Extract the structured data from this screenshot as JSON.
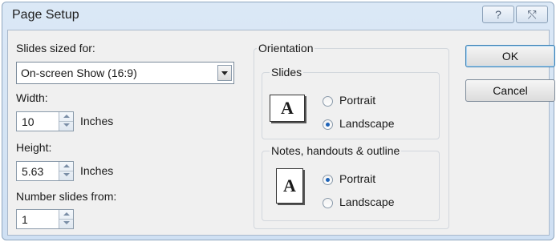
{
  "window": {
    "title": "Page Setup",
    "help_glyph": "?",
    "close_glyph": "⤲"
  },
  "slides_sized_for": {
    "label": "Slides sized for:",
    "selected": "On-screen Show (16:9)"
  },
  "width": {
    "label": "Width:",
    "value": "10",
    "unit": "Inches"
  },
  "height": {
    "label": "Height:",
    "value": "5.63",
    "unit": "Inches"
  },
  "number_slides_from": {
    "label": "Number slides from:",
    "value": "1"
  },
  "orientation": {
    "label": "Orientation",
    "slides": {
      "label": "Slides",
      "icon_glyph": "A",
      "options": [
        {
          "label": "Portrait",
          "selected": false
        },
        {
          "label": "Landscape",
          "selected": true
        }
      ]
    },
    "notes": {
      "label": "Notes, handouts & outline",
      "icon_glyph": "A",
      "options": [
        {
          "label": "Portrait",
          "selected": true
        },
        {
          "label": "Landscape",
          "selected": false
        }
      ]
    }
  },
  "buttons": {
    "ok": "OK",
    "cancel": "Cancel"
  }
}
